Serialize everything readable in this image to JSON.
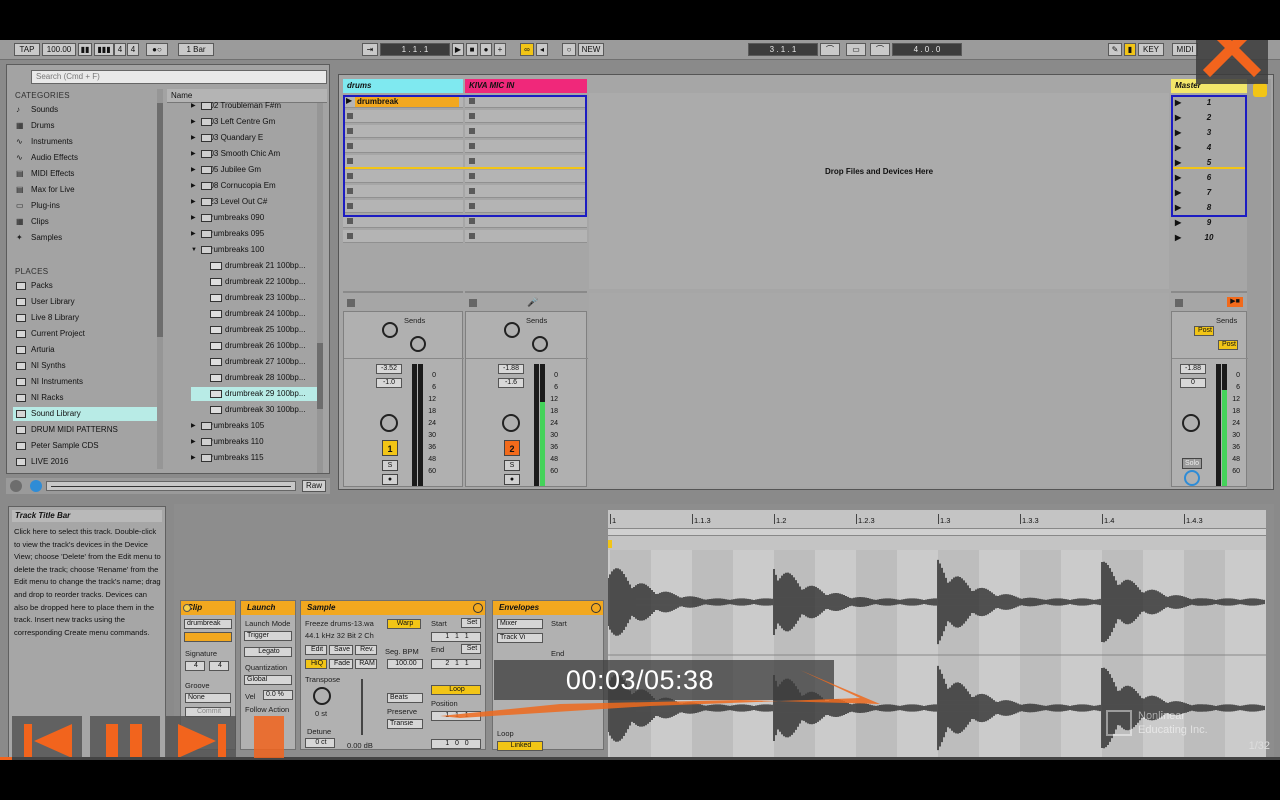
{
  "topbar": {
    "tap": "TAP",
    "tempo": "100.00",
    "sig_num": "4",
    "sig_den": "4",
    "quantize": "1 Bar",
    "position": "1 .   1 .   1",
    "new": "NEW",
    "loop_start": "3 .   1 .   1",
    "loop_len": "4 .   0 .   0",
    "key": "KEY",
    "midi": "MIDI"
  },
  "browser": {
    "search_placeholder": "Search (Cmd + F)",
    "categories_label": "CATEGORIES",
    "categories": [
      "Sounds",
      "Drums",
      "Instruments",
      "Audio Effects",
      "MIDI Effects",
      "Max for Live",
      "Plug-ins",
      "Clips",
      "Samples"
    ],
    "places_label": "PLACES",
    "places": [
      "Packs",
      "User Library",
      "Live 8 Library",
      "Current Project",
      "Arturia",
      "NI Synths",
      "NI Instruments",
      "NI Racks",
      "Sound Library",
      "DRUM MIDI PATTERNS",
      "Peter Sample CDS",
      "LIVE 2016"
    ],
    "selected_place": "Sound Library",
    "name_header": "Name",
    "files": [
      {
        "name": "102 Troubleman F#m",
        "kind": "folder"
      },
      {
        "name": "103 Left Centre Gm",
        "kind": "folder"
      },
      {
        "name": "103 Quandary E",
        "kind": "folder"
      },
      {
        "name": "103 Smooth Chic Am",
        "kind": "folder"
      },
      {
        "name": "105 Jubilee Gm",
        "kind": "folder"
      },
      {
        "name": "108 Cornucopia Em",
        "kind": "folder"
      },
      {
        "name": "123 Level Out C#",
        "kind": "folder"
      },
      {
        "name": "Drumbreaks 090",
        "kind": "folder"
      },
      {
        "name": "Drumbreaks 095",
        "kind": "folder"
      },
      {
        "name": "Drumbreaks 100",
        "kind": "open"
      },
      {
        "name": "drumbreak 21 100bp...",
        "kind": "wav"
      },
      {
        "name": "drumbreak 22 100bp...",
        "kind": "wav"
      },
      {
        "name": "drumbreak 23 100bp...",
        "kind": "wav"
      },
      {
        "name": "drumbreak 24 100bp...",
        "kind": "wav"
      },
      {
        "name": "drumbreak 25 100bp...",
        "kind": "wav"
      },
      {
        "name": "drumbreak 26 100bp...",
        "kind": "wav"
      },
      {
        "name": "drumbreak 27 100bp...",
        "kind": "wav"
      },
      {
        "name": "drumbreak 28 100bp...",
        "kind": "wav"
      },
      {
        "name": "drumbreak 29 100bp...",
        "kind": "wav",
        "selected": true
      },
      {
        "name": "drumbreak 30 100bp...",
        "kind": "wav"
      },
      {
        "name": "Drumbreaks 105",
        "kind": "folder"
      },
      {
        "name": "Drumbreaks 110",
        "kind": "folder"
      },
      {
        "name": "Drumbreaks 115",
        "kind": "folder"
      }
    ],
    "raw": "Raw"
  },
  "session": {
    "tracks": [
      {
        "name": "drums",
        "color": "#7fe9f0",
        "clip": "drumbreak",
        "vol": "-3.52",
        "pan": "-1.0",
        "num": "1",
        "num_color": "#f2c516"
      },
      {
        "name": "KIVA MIC IN",
        "color": "#f0287a",
        "clip": "",
        "vol": "-1.88",
        "pan": "-1.6",
        "num": "2",
        "num_color": "#f26a1b"
      }
    ],
    "drop_text": "Drop Files and Devices Here",
    "master": {
      "name": "Master",
      "color": "#f3e76a",
      "scenes": [
        "1",
        "2",
        "3",
        "4",
        "5",
        "6",
        "7",
        "8",
        "9",
        "10"
      ],
      "vol": "-1.88",
      "pan": "0",
      "post": "Post",
      "solo": "Solo"
    },
    "sends": "Sends",
    "scale": [
      "0",
      "6",
      "12",
      "18",
      "24",
      "30",
      "36",
      "48",
      "60"
    ]
  },
  "info": {
    "title": "Track Title Bar",
    "text": "Click here to select this track. Double-click to view the track's devices in the Device View; choose 'Delete' from the Edit menu to delete the track; choose 'Rename' from the Edit menu to change the track's name; drag and drop to reorder tracks. Devices can also be dropped here to place them in the track. Insert new tracks using the corresponding Create menu commands."
  },
  "clip": {
    "clip_title": "Clip",
    "clip_name": "drumbreak",
    "signature_label": "Signature",
    "sig_num": "4",
    "sig_den": "4",
    "groove_label": "Groove",
    "groove": "None",
    "commit": "Commit",
    "launch_title": "Launch",
    "launch_mode_label": "Launch Mode",
    "launch_mode": "Trigger",
    "legato": "Legato",
    "quant_label": "Quantization",
    "quant": "Global",
    "vel_label": "Vel",
    "vel": "0.0 %",
    "follow_label": "Follow Action",
    "sample_title": "Sample",
    "sample_file": "Freeze drums-13.wa",
    "sample_info": "44.1 kHz 32 Bit 2 Ch",
    "edit": "Edit",
    "save": "Save",
    "rev": "Rev.",
    "hiq": "HiQ",
    "fade": "Fade",
    "ram": "RAM",
    "transpose_label": "Transpose",
    "transpose": "0 st",
    "detune_label": "Detune",
    "detune": "0 ct",
    "gain": "0.00 dB",
    "warp": "Warp",
    "seg_bpm_label": "Seg. BPM",
    "seg_bpm": "100.00",
    "beats": "Beats",
    "preserve": "Preserve",
    "transients": "Transie",
    "start_label": "Start",
    "end_label": "End",
    "set": "Set",
    "loop": "Loop",
    "position_label": "Position",
    "env_title": "Envelopes",
    "env_device": "Mixer",
    "env_ctrl": "Track Vi",
    "env_start": "Start",
    "env_end": "End",
    "env_loop": "Loop",
    "linked": "Linked"
  },
  "ruler": [
    "1",
    "1.1.3",
    "1.2",
    "1.2.3",
    "1.3",
    "1.3.3",
    "1.4",
    "1.4.3"
  ],
  "player": {
    "time": "00:03/05:38",
    "page": "1/32",
    "brand_line1": "Nonlinear",
    "brand_line2": "Educating Inc.",
    "progress": 0.009
  }
}
